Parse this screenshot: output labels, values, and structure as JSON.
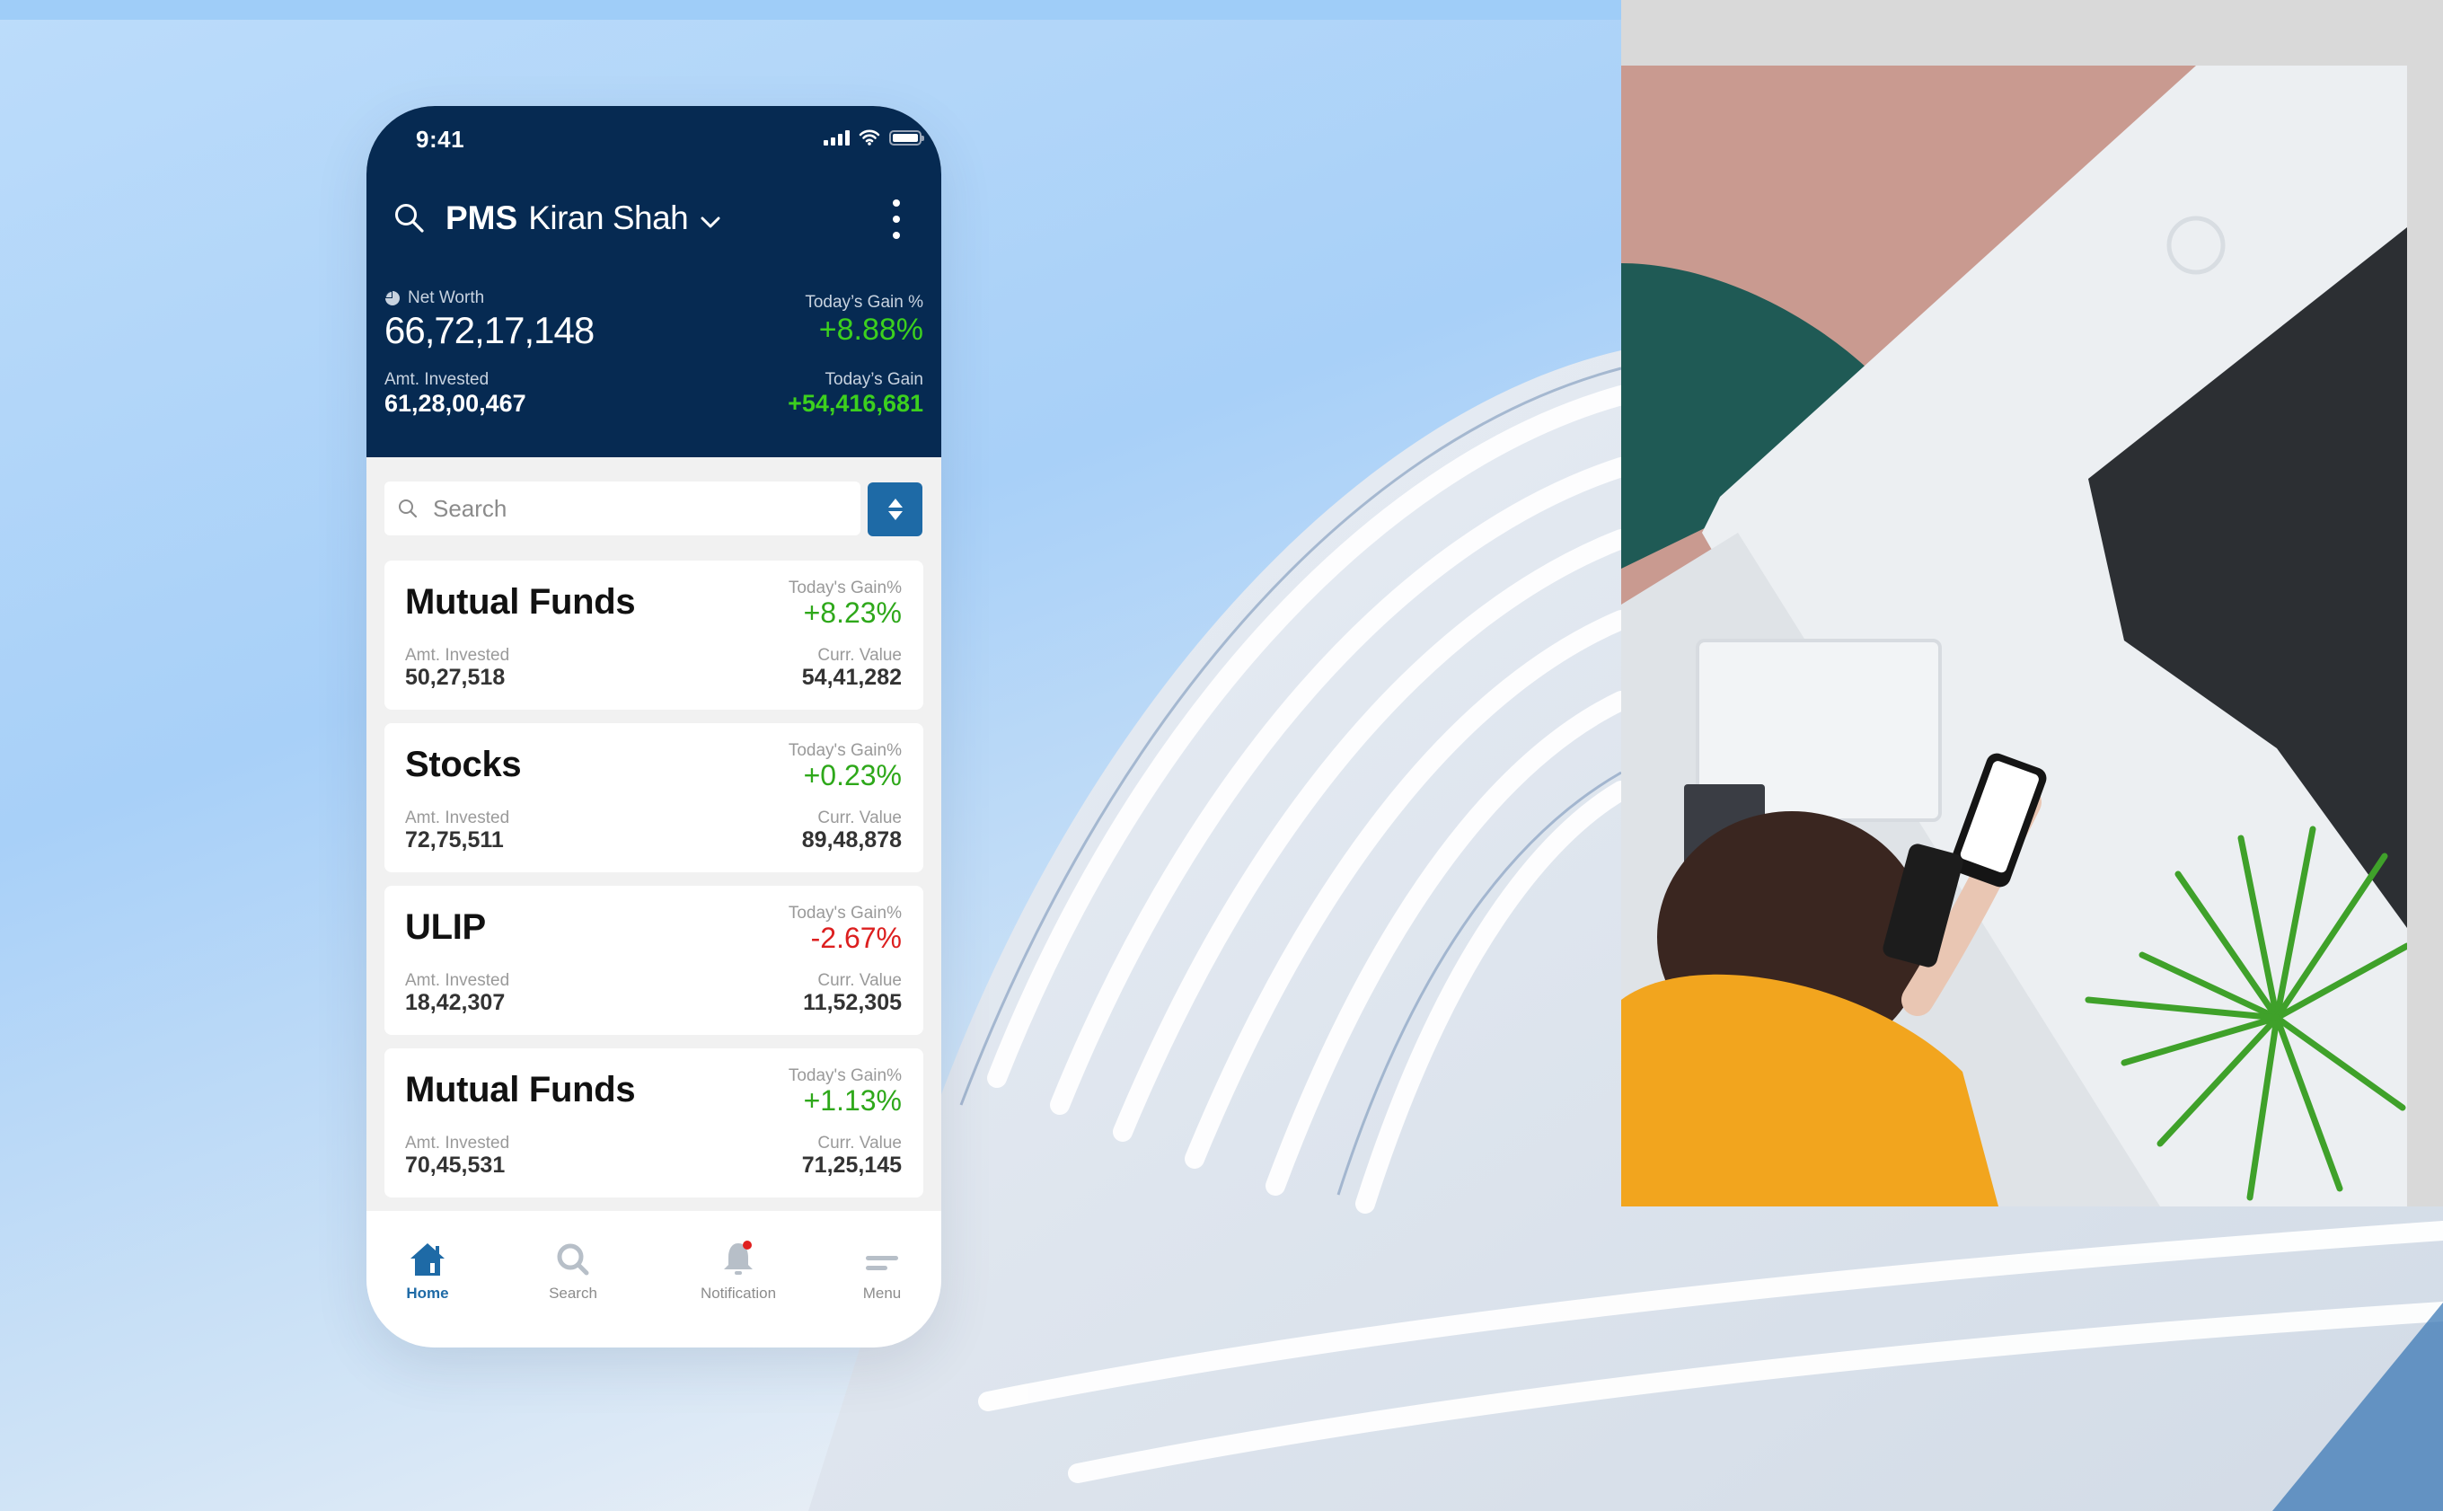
{
  "status_bar": {
    "time": "9:41",
    "icons": [
      "cellular-signal-icon",
      "wifi-icon",
      "battery-icon"
    ]
  },
  "header": {
    "search_icon": "search-icon",
    "app_label": "PMS",
    "account_name": "Kiran Shah",
    "account_dropdown_icon": "chevron-down-icon",
    "more_icon": "more-vertical-icon"
  },
  "summary": {
    "net_worth_icon": "pie-chart-icon",
    "net_worth_label": "Net Worth",
    "net_worth_value": "66,72,17,148",
    "todays_gain_pct_label": "Today’s Gain %",
    "todays_gain_pct_value": "+8.88%",
    "amt_invested_label": "Amt. Invested",
    "amt_invested_value": "61,28,00,467",
    "todays_gain_label": "Today’s Gain",
    "todays_gain_value": "+54,416,681"
  },
  "search": {
    "placeholder": "Search",
    "value": "",
    "sort_icon": "sort-icon"
  },
  "portfolio": [
    {
      "name": "Mutual Funds",
      "gain_label": "Today's Gain%",
      "gain_value": "+8.23%",
      "trend": "positive",
      "invested_label": "Amt. Invested",
      "invested_value": "50,27,518",
      "current_label": "Curr. Value",
      "current_value": "54,41,282"
    },
    {
      "name": "Stocks",
      "gain_label": "Today's Gain%",
      "gain_value": "+0.23%",
      "trend": "positive",
      "invested_label": "Amt. Invested",
      "invested_value": "72,75,511",
      "current_label": "Curr. Value",
      "current_value": "89,48,878"
    },
    {
      "name": "ULIP",
      "gain_label": "Today's Gain%",
      "gain_value": "-2.67%",
      "trend": "negative",
      "invested_label": "Amt. Invested",
      "invested_value": "18,42,307",
      "current_label": "Curr. Value",
      "current_value": "11,52,305"
    },
    {
      "name": "Mutual Funds",
      "gain_label": "Today's Gain%",
      "gain_value": "+1.13%",
      "trend": "positive",
      "invested_label": "Amt. Invested",
      "invested_value": "70,45,531",
      "current_label": "Curr. Value",
      "current_value": "71,25,145"
    }
  ],
  "bottom_nav": [
    {
      "label": "Home",
      "icon": "home-icon",
      "active": true
    },
    {
      "label": "Search",
      "icon": "search-icon",
      "active": false
    },
    {
      "label": "Notification",
      "icon": "bell-icon",
      "active": false,
      "badge": true
    },
    {
      "label": "Menu",
      "icon": "menu-icon",
      "active": false
    }
  ],
  "colors": {
    "header_bg": "#062a52",
    "accent": "#1e6aa6",
    "positive": "#2ea81a",
    "positive_header": "#3cd01e",
    "negative": "#dc1f1f",
    "badge": "#e0201f"
  }
}
